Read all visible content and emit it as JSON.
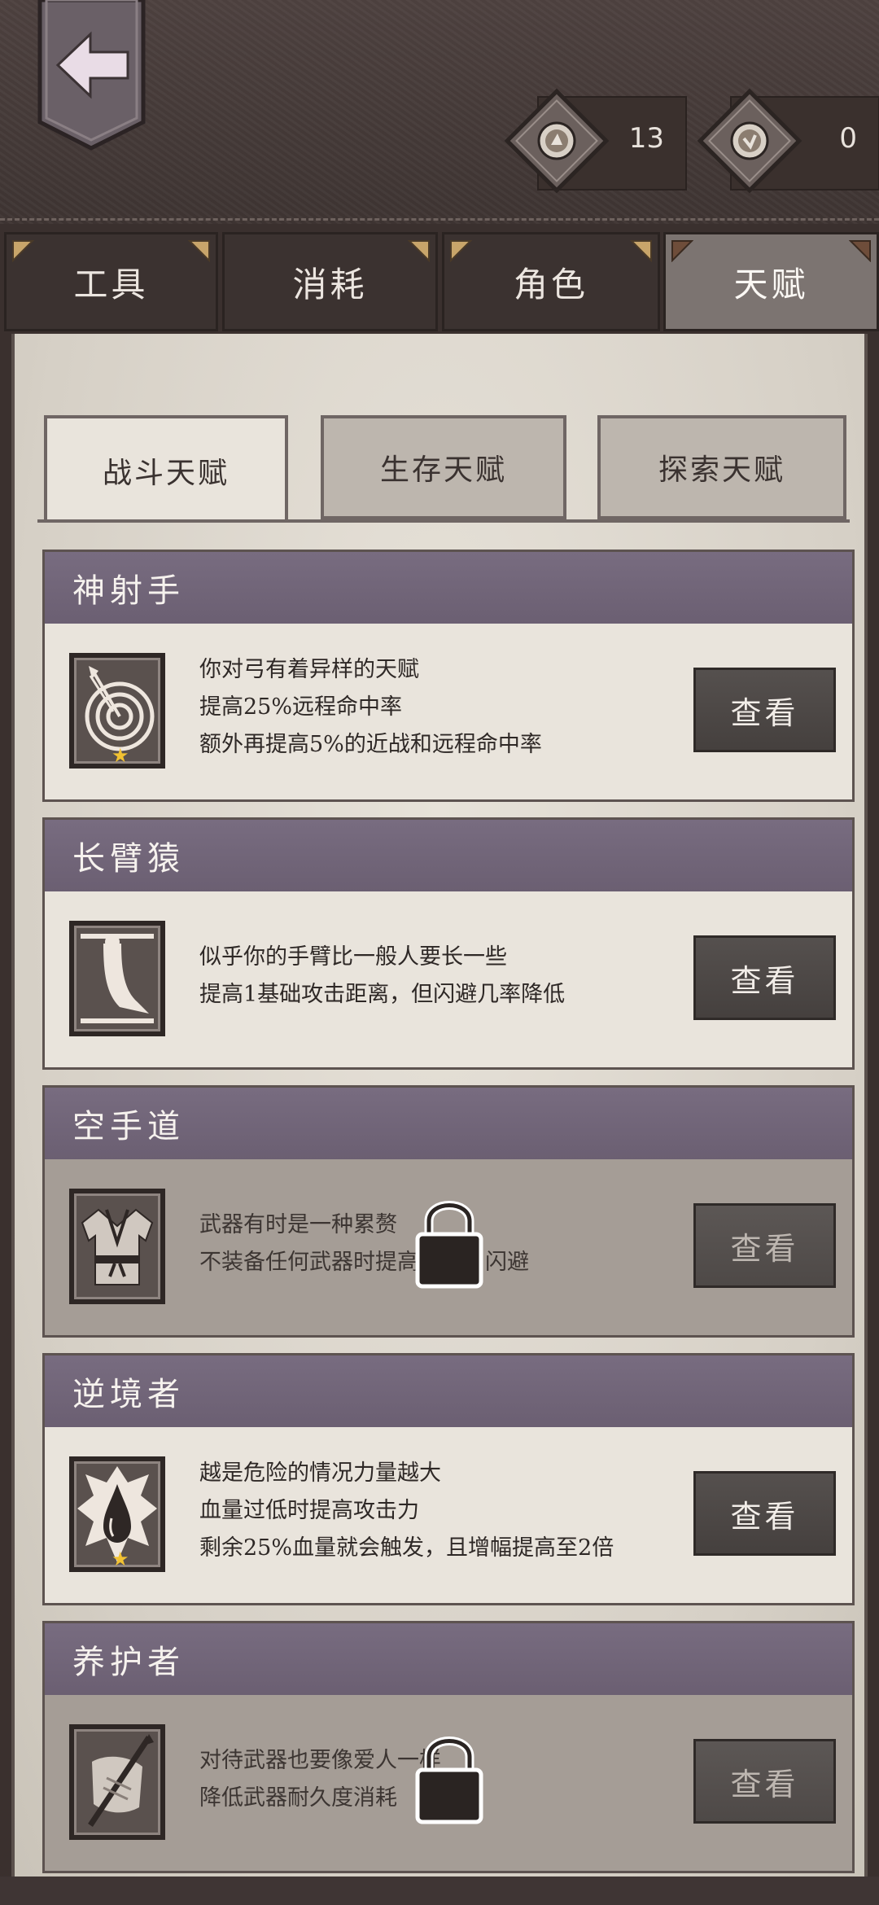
{
  "header": {
    "currency_a": "13",
    "currency_b": "0"
  },
  "tabs": [
    {
      "label": "工具",
      "active": false
    },
    {
      "label": "消耗",
      "active": false
    },
    {
      "label": "角色",
      "active": false
    },
    {
      "label": "天赋",
      "active": true
    }
  ],
  "subtabs": [
    {
      "label": "战斗天赋",
      "active": true
    },
    {
      "label": "生存天赋",
      "active": false
    },
    {
      "label": "探索天赋",
      "active": false
    }
  ],
  "talents": [
    {
      "name": "神射手",
      "icon": "archery-target-icon",
      "starred": true,
      "locked": false,
      "lines": [
        "你对弓有着异样的天赋",
        "提高25%远程命中率",
        "额外再提高5%的近战和远程命中率"
      ],
      "button": "查看"
    },
    {
      "name": "长臂猿",
      "icon": "long-arm-icon",
      "starred": false,
      "locked": false,
      "lines": [
        "似乎你的手臂比一般人要长一些",
        "提高1基础攻击距离，但闪避几率降低"
      ],
      "button": "查看"
    },
    {
      "name": "空手道",
      "icon": "karate-gi-icon",
      "starred": false,
      "locked": true,
      "lines": [
        "武器有时是一种累赘",
        "不装备任何武器时提高攻击和闪避"
      ],
      "button": "查看"
    },
    {
      "name": "逆境者",
      "icon": "blood-drop-icon",
      "starred": true,
      "locked": false,
      "lines": [
        "越是危险的情况力量越大",
        "血量过低时提高攻击力",
        "剩余25%血量就会触发，且增幅提高至2倍"
      ],
      "button": "查看"
    },
    {
      "name": "养护者",
      "icon": "weapon-care-icon",
      "starred": false,
      "locked": true,
      "lines": [
        "对待武器也要像爱人一样",
        "降低武器耐久度消耗"
      ],
      "button": "查看"
    }
  ],
  "colors": {
    "card_header": "#716578",
    "parchment": "#e9e4dc",
    "leather": "#4a3f3d",
    "star": "#f2c232"
  }
}
